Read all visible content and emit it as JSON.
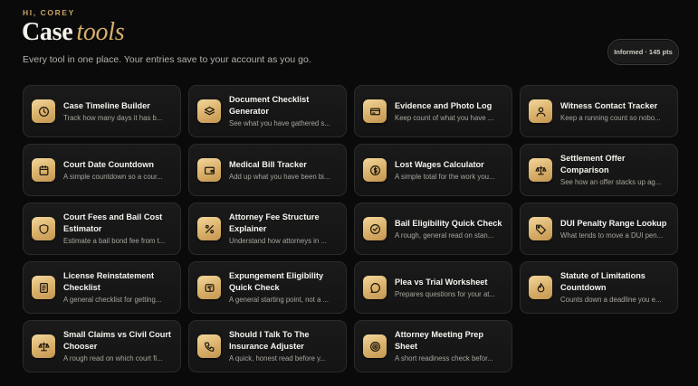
{
  "header": {
    "greeting": "HI, COREY",
    "title_main": "Case",
    "title_accent": "tools",
    "subtitle": "Every tool in one place. Your entries save to your account as you go.",
    "badge": "Informed · 145 pts"
  },
  "accent_color": "#d8b06b",
  "tools": [
    {
      "name": "Case Timeline Builder",
      "desc": "Track how many days it has b...",
      "icon": "clock-icon"
    },
    {
      "name": "Document Checklist Generator",
      "desc": "See what you have gathered s...",
      "icon": "layers-icon"
    },
    {
      "name": "Evidence and Photo Log",
      "desc": "Keep count of what you have ...",
      "icon": "card-icon"
    },
    {
      "name": "Witness Contact Tracker",
      "desc": "Keep a running count so nobo...",
      "icon": "user-icon"
    },
    {
      "name": "Court Date Countdown",
      "desc": "A simple countdown so a cour...",
      "icon": "calendar-icon"
    },
    {
      "name": "Medical Bill Tracker",
      "desc": "Add up what you have been bi...",
      "icon": "wallet-icon"
    },
    {
      "name": "Lost Wages Calculator",
      "desc": "A simple total for the work you...",
      "icon": "dollar-icon"
    },
    {
      "name": "Settlement Offer Comparison",
      "desc": "See how an offer stacks up ag...",
      "icon": "scale-icon"
    },
    {
      "name": "Court Fees and Bail Cost Estimator",
      "desc": "Estimate a bail bond fee from t...",
      "icon": "shield-icon"
    },
    {
      "name": "Attorney Fee Structure Explainer",
      "desc": "Understand how attorneys in ...",
      "icon": "percent-icon"
    },
    {
      "name": "Bail Eligibility Quick Check",
      "desc": "A rough, general read on stan...",
      "icon": "check-circle-icon"
    },
    {
      "name": "DUI Penalty Range Lookup",
      "desc": "What tends to move a DUI pen...",
      "icon": "tag-icon"
    },
    {
      "name": "License Reinstatement Checklist",
      "desc": "A general checklist for getting...",
      "icon": "document-icon"
    },
    {
      "name": "Expungement Eligibility Quick Check",
      "desc": "A general starting point, not a ...",
      "icon": "eraser-icon"
    },
    {
      "name": "Plea vs Trial Worksheet",
      "desc": "Prepares questions for your at...",
      "icon": "chat-icon"
    },
    {
      "name": "Statute of Limitations Countdown",
      "desc": "Counts down a deadline you e...",
      "icon": "flame-icon"
    },
    {
      "name": "Small Claims vs Civil Court Chooser",
      "desc": "A rough read on which court fi...",
      "icon": "scale-icon"
    },
    {
      "name": "Should I Talk To The Insurance Adjuster",
      "desc": "A quick, honest read before y...",
      "icon": "phone-icon"
    },
    {
      "name": "Attorney Meeting Prep Sheet",
      "desc": "A short readiness check befor...",
      "icon": "target-icon"
    }
  ]
}
